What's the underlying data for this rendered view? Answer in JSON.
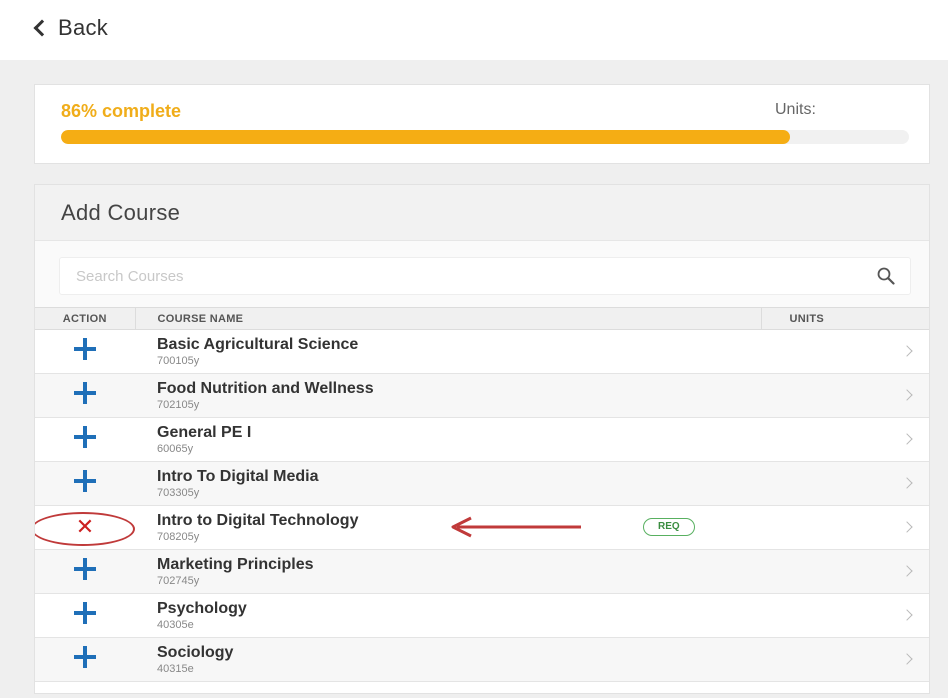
{
  "header": {
    "back_label": "Back"
  },
  "progress": {
    "label": "86% complete",
    "value": 0.86,
    "units_label": "Units:",
    "bar_color": "#f5ad14"
  },
  "course_panel": {
    "title": "Add Course",
    "search_placeholder": "Search Courses",
    "columns": {
      "action": "ACTION",
      "name": "COURSE NAME",
      "units": "UNITS"
    },
    "courses": [
      {
        "name": "Basic Agricultural Science",
        "code": "700105y",
        "action": "add"
      },
      {
        "name": "Food Nutrition and Wellness",
        "code": "702105y",
        "action": "add"
      },
      {
        "name": "General PE I",
        "code": "60065y",
        "action": "add"
      },
      {
        "name": "Intro To Digital Media",
        "code": "703305y",
        "action": "add"
      },
      {
        "name": "Intro to Digital Technology",
        "code": "708205y",
        "action": "remove",
        "badge": "REQ"
      },
      {
        "name": "Marketing Principles",
        "code": "702745y",
        "action": "add"
      },
      {
        "name": "Psychology",
        "code": "40305e",
        "action": "add"
      },
      {
        "name": "Sociology",
        "code": "40315e",
        "action": "add"
      }
    ]
  },
  "colors": {
    "accent": "#f0ad1a",
    "plus": "#1f6fb8",
    "remove": "#cc2020",
    "req": "#3a8d40",
    "annotation": "#c03a3a"
  }
}
